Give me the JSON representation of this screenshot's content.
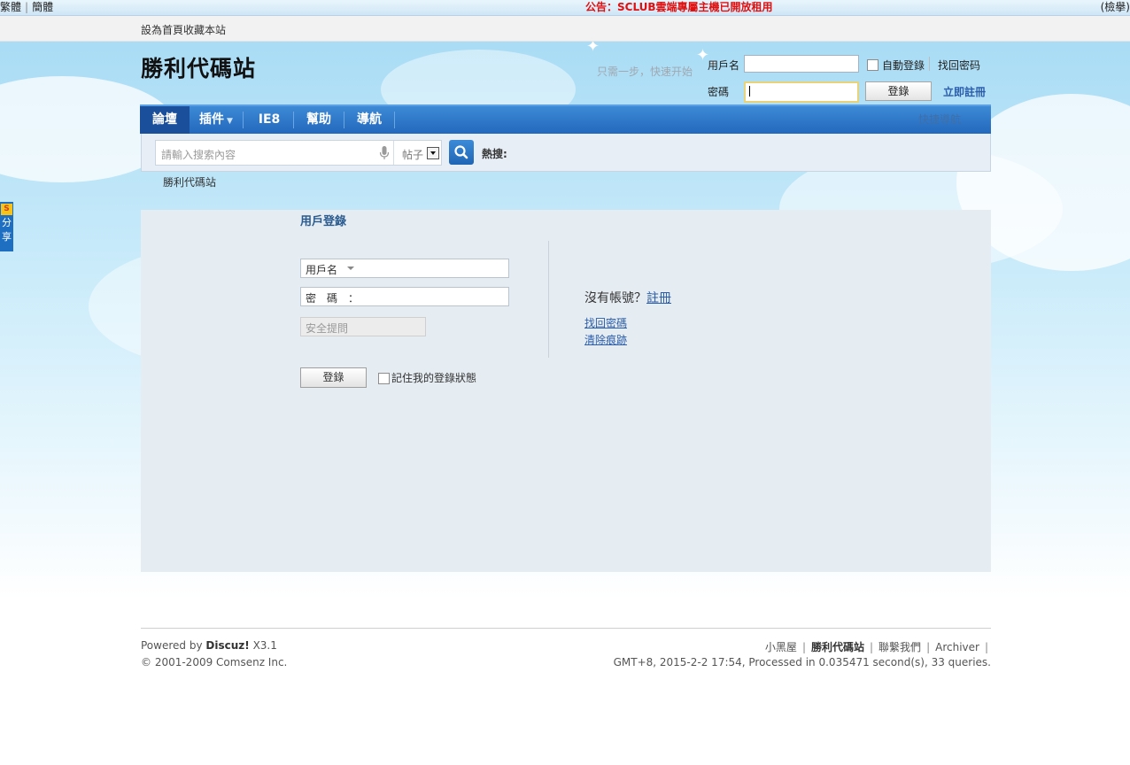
{
  "topbar": {
    "lang_traditional": "繁體",
    "lang_simplified": "簡體",
    "notice": "公告：SCLUB雲端專屬主機已開放租用",
    "right_text": "(檢擧)"
  },
  "subbar": {
    "set_home": "設為首頁收藏本站"
  },
  "site": {
    "logo": "勝利代碼站"
  },
  "header_login": {
    "quick_start": "只需一步，快速开始",
    "username_label": "用戶名",
    "password_label": "密碼",
    "auto_login": "自動登錄",
    "find_password": "找回密码",
    "login_button": "登錄",
    "register": "立即註冊"
  },
  "nav": {
    "items": [
      {
        "label": "論壇"
      },
      {
        "label": "插件"
      },
      {
        "label": "IE8"
      },
      {
        "label": "幫助"
      },
      {
        "label": "導航"
      }
    ],
    "right": "快捷導航"
  },
  "search": {
    "placeholder": "請輸入搜索內容",
    "type": "帖子",
    "hot_label": "熱搜:"
  },
  "breadcrumb": "勝利代碼站",
  "login_panel": {
    "title": "用戶登錄",
    "username_selector": "用戶名",
    "password_label": "密　碼　：",
    "security_question": "安全提問",
    "login_button": "登錄",
    "remember": "記住我的登錄狀態",
    "no_account": "沒有帳號？",
    "register_link": "註冊",
    "find_password": "找回密碼",
    "clear_traces": "清除痕跡"
  },
  "side_share": {
    "label1": "分",
    "label2": "享"
  },
  "footer": {
    "powered_by_prefix": "Powered by",
    "powered_by_brand": "Discuz!",
    "version": "X3.1",
    "copyright": "© 2001-2009 Comsenz Inc.",
    "links": [
      "小黑屋",
      "勝利代碼站",
      "聯繫我們",
      "Archiver"
    ],
    "stats": "GMT+8, 2015-2-2 17:54, Processed in 0.035471 second(s), 33 queries."
  }
}
